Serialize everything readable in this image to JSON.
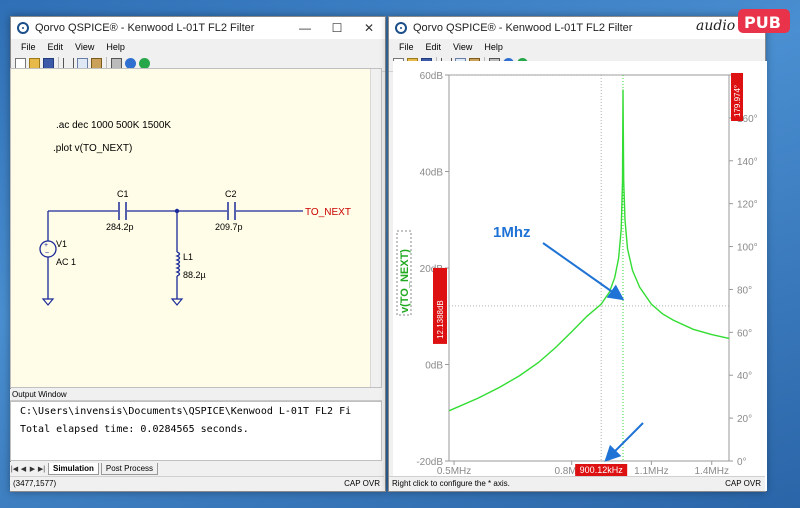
{
  "left_window": {
    "title": "Qorvo QSPICE® - Kenwood L-01T FL2 Filter",
    "menu": [
      "File",
      "Edit",
      "View",
      "Help"
    ],
    "caption": {
      "minimize": "—",
      "maximize": "☐",
      "close": "✕"
    },
    "schematic": {
      "directive_ac": ".ac dec 1000 500K 1500K",
      "directive_plot": ".plot v(TO_NEXT)",
      "c1_name": "C1",
      "c1_value": "284.2p",
      "c2_name": "C2",
      "c2_value": "209.7p",
      "l1_name": "L1",
      "l1_value": "88.2µ",
      "v1_name": "V1",
      "v1_value": "AC 1",
      "net_label": "TO_NEXT"
    },
    "output": {
      "title": "Output Window",
      "line1": "C:\\Users\\invensis\\Documents\\QSPICE\\Kenwood L-01T FL2 Fi",
      "line2": "Total elapsed time: 0.0284565 seconds."
    },
    "tabs": [
      "Simulation",
      "Post Process"
    ],
    "status_left": "(3477,1577)",
    "status_right": "CAP  OVR"
  },
  "right_window": {
    "title": "Qorvo QSPICE® - Kenwood L-01T FL2 Filter",
    "menu": [
      "File",
      "Edit",
      "View",
      "Help"
    ],
    "status_left": "Right click to configure the * axis.",
    "status_right": "CAP  OVR",
    "annotation_text": "1Mhz",
    "cursor_x_readout": "900.12kHz",
    "cursor_y_readout": "12.1388dB",
    "cursor_phase_readout": "179.974°",
    "trace_label": "v(TO_NEXT)"
  },
  "logo": {
    "text": "audioPUB"
  },
  "chart_data": {
    "type": "line",
    "title": "",
    "xlabel": "",
    "ylabel": "v(TO_NEXT)",
    "x_scale": "log",
    "xlim": [
      490000,
      1500000
    ],
    "ylim": [
      -20,
      60
    ],
    "y2lim": [
      0,
      180
    ],
    "x_tick_labels": [
      "0.5MHz",
      "0.8MHz",
      "1.1MHz",
      "1.4MHz"
    ],
    "x_ticks": [
      500000,
      800000,
      1100000,
      1400000
    ],
    "y_tick_labels": [
      "60dB",
      "40dB",
      "20dB",
      "0dB",
      "-20dB"
    ],
    "y_ticks": [
      60,
      40,
      20,
      0,
      -20
    ],
    "y2_tick_labels": [
      "180°",
      "160°",
      "140°",
      "120°",
      "100°",
      "80°",
      "60°",
      "40°",
      "20°",
      "0°"
    ],
    "y2_ticks": [
      180,
      160,
      140,
      120,
      100,
      80,
      60,
      40,
      20,
      0
    ],
    "color": "#33dd33",
    "series": [
      {
        "name": "v(TO_NEXT)",
        "x": [
          490000,
          550000,
          600000,
          650000,
          700000,
          750000,
          800000,
          850000,
          900000,
          930000,
          950000,
          965000,
          975000,
          980000,
          982000,
          985000,
          990000,
          1000000,
          1020000,
          1050000,
          1100000,
          1150000,
          1200000,
          1300000,
          1400000,
          1500000
        ],
        "y": [
          -9.6,
          -7,
          -4.7,
          -2.3,
          0.4,
          3.5,
          6.8,
          10,
          12.5,
          15,
          18,
          22,
          28,
          38,
          57,
          38,
          30,
          24,
          19.5,
          16,
          12.5,
          10.5,
          9.2,
          7.3,
          6.2,
          5.4
        ]
      }
    ],
    "cursor_x": 900120,
    "resonance_x": 982000,
    "grid": true
  }
}
